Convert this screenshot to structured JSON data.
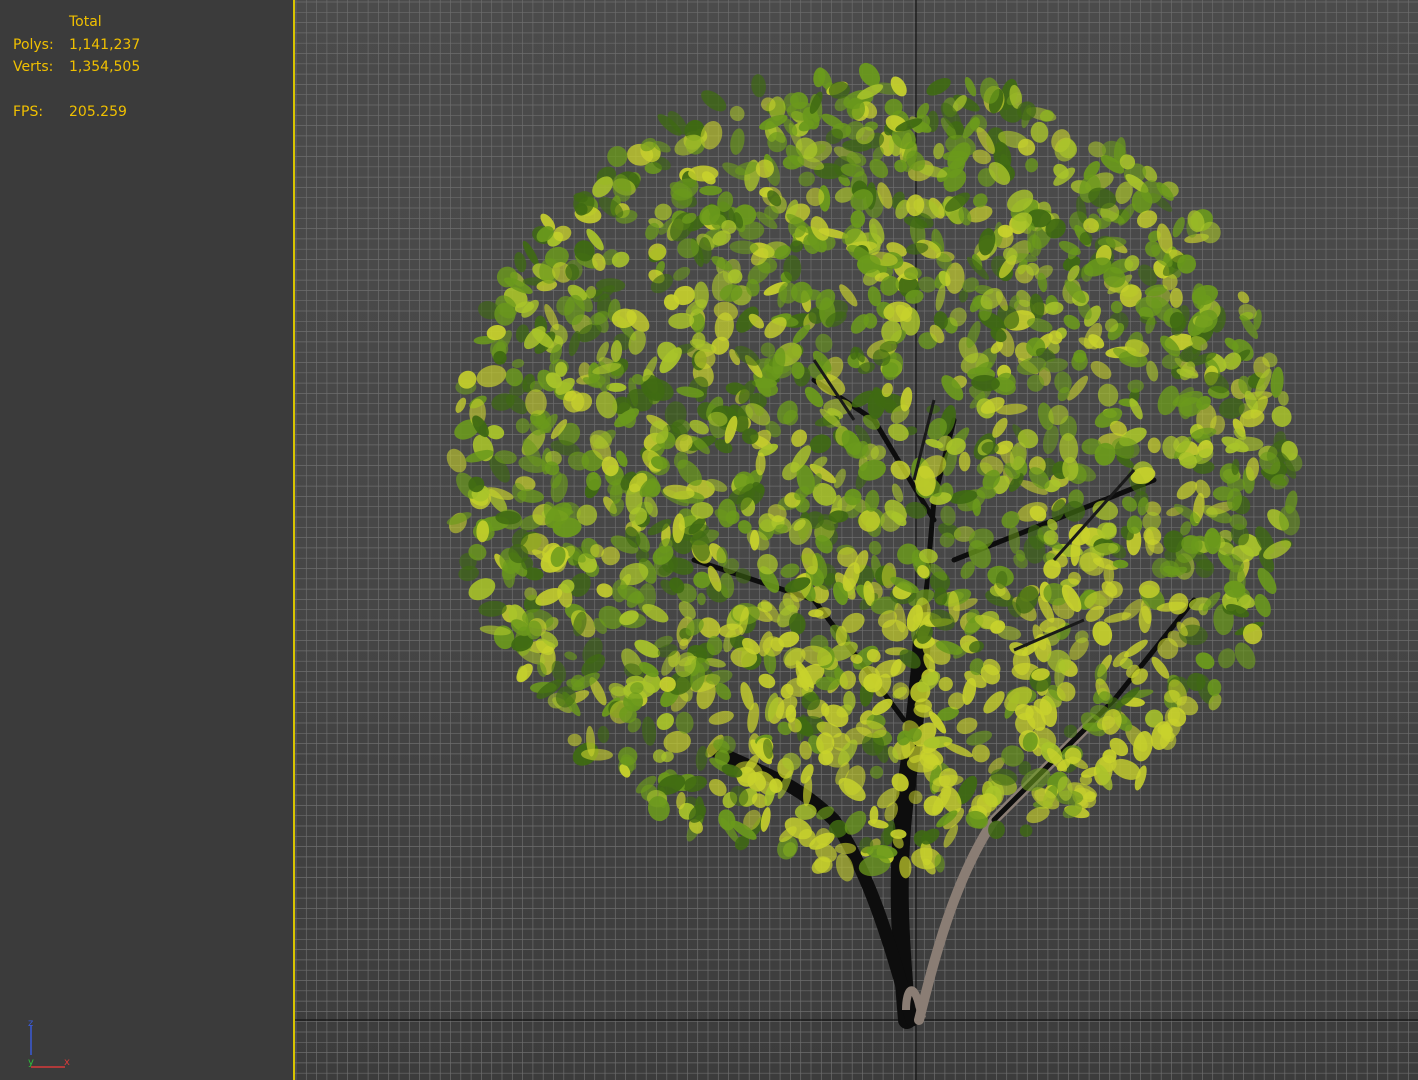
{
  "stats": {
    "header": "Total",
    "polys_label": "Polys:",
    "polys_value": "1,141,237",
    "verts_label": "Verts:",
    "verts_value": "1,354,505",
    "fps_label": "FPS:",
    "fps_value": "205.259"
  },
  "axis_gizmo": {
    "z_label": "z",
    "y_label": "y",
    "x_label": "x",
    "z_color": "#3a5bd8",
    "y_color": "#2fbf3a",
    "x_color": "#d83a3a"
  },
  "colors": {
    "stats_text": "#f0c000",
    "viewport_border": "#d8c400",
    "foliage_dark": "#3f6a12",
    "foliage_mid": "#6b9a1c",
    "foliage_light": "#a9c42a",
    "foliage_yellow": "#c8d22c",
    "trunk_dark": "#0d0d0d",
    "trunk_light": "#8a7d74"
  }
}
